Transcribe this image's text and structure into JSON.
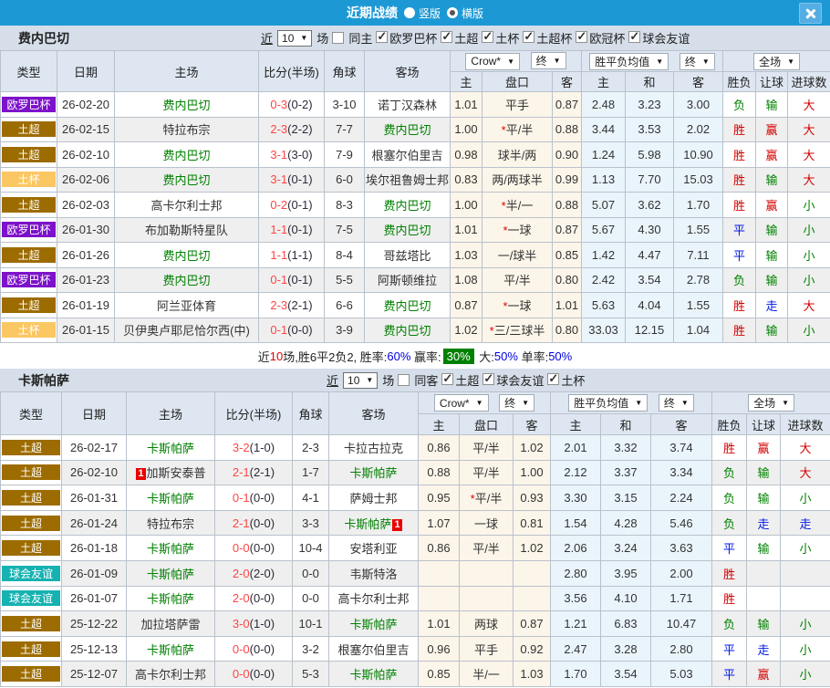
{
  "topbar": {
    "title": "近期战绩",
    "vertical_label": "竖版",
    "horizontal_label": "横版",
    "selected": "横版"
  },
  "league_colors": {
    "欧罗巴杯": "#7d12ca",
    "土超": "#9d6c00",
    "土杯": "#fbc763",
    "球会友谊": "#16b2b2"
  },
  "columns": {
    "type": "类型",
    "date": "日期",
    "home": "主场",
    "score": "比分(半场)",
    "corner": "角球",
    "away": "客场",
    "odds_home": "主",
    "handicap": "盘口",
    "odds_away": "客",
    "mean_home": "主",
    "mean_draw": "和",
    "mean_away": "客",
    "outcome": "胜负",
    "handicap_result": "让球",
    "goals": "进球数"
  },
  "header_selects": {
    "odds_source": "Crow*",
    "odds_final": "终",
    "mean_source": "胜平负均值",
    "mean_final": "终",
    "scope": "全场"
  },
  "sections": [
    {
      "team": "费内巴切",
      "filter": {
        "near": "近",
        "count": "10",
        "games": "场",
        "same_label": "同主",
        "same_checked": false,
        "leagues": [
          "欧罗巴杯",
          "土超",
          "土杯",
          "土超杯",
          "欧冠杯",
          "球会友谊"
        ]
      },
      "rows": [
        {
          "league": "欧罗巴杯",
          "date": "26-02-20",
          "home": {
            "name": "费内巴切",
            "focal": true
          },
          "ft": "0-3",
          "ht": "(0-2)",
          "corner": "3-10",
          "away": {
            "name": "诺丁汉森林"
          },
          "odds": [
            "1.01",
            "平手",
            "0.87"
          ],
          "mean": [
            "2.48",
            "3.23",
            "3.00"
          ],
          "outcome": [
            "负",
            "green"
          ],
          "let": [
            "输",
            "green"
          ],
          "goal": [
            "大",
            "red"
          ]
        },
        {
          "league": "土超",
          "date": "26-02-15",
          "home": {
            "name": "特拉布宗"
          },
          "ft": "2-3",
          "ht": "(2-2)",
          "corner": "7-7",
          "away": {
            "name": "费内巴切",
            "focal": true
          },
          "odds": [
            "1.00",
            "*平/半",
            "0.88"
          ],
          "mean": [
            "3.44",
            "3.53",
            "2.02"
          ],
          "outcome": [
            "胜",
            "red"
          ],
          "let": [
            "赢",
            "red"
          ],
          "goal": [
            "大",
            "red"
          ]
        },
        {
          "league": "土超",
          "date": "26-02-10",
          "home": {
            "name": "费内巴切",
            "focal": true
          },
          "ft": "3-1",
          "ht": "(3-0)",
          "corner": "7-9",
          "away": {
            "name": "根塞尔伯里吉"
          },
          "odds": [
            "0.98",
            "球半/两",
            "0.90"
          ],
          "mean": [
            "1.24",
            "5.98",
            "10.90"
          ],
          "outcome": [
            "胜",
            "red"
          ],
          "let": [
            "赢",
            "red"
          ],
          "goal": [
            "大",
            "red"
          ]
        },
        {
          "league": "土杯",
          "date": "26-02-06",
          "home": {
            "name": "费内巴切",
            "focal": true
          },
          "ft": "3-1",
          "ht": "(0-1)",
          "corner": "6-0",
          "away": {
            "name": "埃尔祖鲁姆士邦"
          },
          "odds": [
            "0.83",
            "两/两球半",
            "0.99"
          ],
          "mean": [
            "1.13",
            "7.70",
            "15.03"
          ],
          "outcome": [
            "胜",
            "red"
          ],
          "let": [
            "输",
            "green"
          ],
          "goal": [
            "大",
            "red"
          ]
        },
        {
          "league": "土超",
          "date": "26-02-03",
          "home": {
            "name": "高卡尔利士邦"
          },
          "ft": "0-2",
          "ht": "(0-1)",
          "corner": "8-3",
          "away": {
            "name": "费内巴切",
            "focal": true
          },
          "odds": [
            "1.00",
            "*半/一",
            "0.88"
          ],
          "mean": [
            "5.07",
            "3.62",
            "1.70"
          ],
          "outcome": [
            "胜",
            "red"
          ],
          "let": [
            "赢",
            "red"
          ],
          "goal": [
            "小",
            "green"
          ]
        },
        {
          "league": "欧罗巴杯",
          "date": "26-01-30",
          "home": {
            "name": "布加勒斯特星队"
          },
          "ft": "1-1",
          "ht": "(0-1)",
          "corner": "7-5",
          "away": {
            "name": "费内巴切",
            "focal": true
          },
          "odds": [
            "1.01",
            "*一球",
            "0.87"
          ],
          "mean": [
            "5.67",
            "4.30",
            "1.55"
          ],
          "outcome": [
            "平",
            "blue"
          ],
          "let": [
            "输",
            "green"
          ],
          "goal": [
            "小",
            "green"
          ]
        },
        {
          "league": "土超",
          "date": "26-01-26",
          "home": {
            "name": "费内巴切",
            "focal": true
          },
          "ft": "1-1",
          "ht": "(1-1)",
          "corner": "8-4",
          "away": {
            "name": "哥兹塔比"
          },
          "odds": [
            "1.03",
            "一/球半",
            "0.85"
          ],
          "mean": [
            "1.42",
            "4.47",
            "7.11"
          ],
          "outcome": [
            "平",
            "blue"
          ],
          "let": [
            "输",
            "green"
          ],
          "goal": [
            "小",
            "green"
          ]
        },
        {
          "league": "欧罗巴杯",
          "date": "26-01-23",
          "home": {
            "name": "费内巴切",
            "focal": true
          },
          "ft": "0-1",
          "ht": "(0-1)",
          "corner": "5-5",
          "away": {
            "name": "阿斯顿维拉"
          },
          "odds": [
            "1.08",
            "平/半",
            "0.80"
          ],
          "mean": [
            "2.42",
            "3.54",
            "2.78"
          ],
          "outcome": [
            "负",
            "green"
          ],
          "let": [
            "输",
            "green"
          ],
          "goal": [
            "小",
            "green"
          ]
        },
        {
          "league": "土超",
          "date": "26-01-19",
          "home": {
            "name": "阿兰亚体育"
          },
          "ft": "2-3",
          "ht": "(2-1)",
          "corner": "6-6",
          "away": {
            "name": "费内巴切",
            "focal": true
          },
          "odds": [
            "0.87",
            "*一球",
            "1.01"
          ],
          "mean": [
            "5.63",
            "4.04",
            "1.55"
          ],
          "outcome": [
            "胜",
            "red"
          ],
          "let": [
            "走",
            "blue"
          ],
          "goal": [
            "大",
            "red"
          ]
        },
        {
          "league": "土杯",
          "date": "26-01-15",
          "home": {
            "name": "贝伊奥卢耶尼恰尔西(中)"
          },
          "ft": "0-1",
          "ht": "(0-0)",
          "corner": "3-9",
          "away": {
            "name": "费内巴切",
            "focal": true
          },
          "odds": [
            "1.02",
            "*三/三球半",
            "0.80"
          ],
          "mean": [
            "33.03",
            "12.15",
            "1.04"
          ],
          "outcome": [
            "胜",
            "red"
          ],
          "let": [
            "输",
            "green"
          ],
          "goal": [
            "小",
            "green"
          ]
        }
      ],
      "summary": [
        {
          "t": "近"
        },
        {
          "t": "10",
          "c": "red"
        },
        {
          "t": "场,胜6平2负2, 胜率:"
        },
        {
          "t": "60%",
          "c": "blue"
        },
        {
          "t": " 赢率:"
        },
        {
          "t": "30%",
          "c": "hl"
        },
        {
          "t": " 大:"
        },
        {
          "t": "50%",
          "c": "blue"
        },
        {
          "t": " 单率:"
        },
        {
          "t": "50%",
          "c": "blue"
        }
      ]
    },
    {
      "team": "卡斯帕萨",
      "filter": {
        "near": "近",
        "count": "10",
        "games": "场",
        "same_label": "同客",
        "same_checked": false,
        "leagues": [
          "土超",
          "球会友谊",
          "土杯"
        ]
      },
      "rows": [
        {
          "league": "土超",
          "date": "26-02-17",
          "home": {
            "name": "卡斯帕萨",
            "focal": true
          },
          "ft": "3-2",
          "ht": "(1-0)",
          "corner": "2-3",
          "away": {
            "name": "卡拉古拉克"
          },
          "odds": [
            "0.86",
            "平/半",
            "1.02"
          ],
          "mean": [
            "2.01",
            "3.32",
            "3.74"
          ],
          "outcome": [
            "胜",
            "red"
          ],
          "let": [
            "赢",
            "red"
          ],
          "goal": [
            "大",
            "red"
          ]
        },
        {
          "league": "土超",
          "date": "26-02-10",
          "home": {
            "name": "加斯安泰普",
            "badge": "1",
            "badge_pos": "before"
          },
          "ft": "2-1",
          "ht": "(2-1)",
          "corner": "1-7",
          "away": {
            "name": "卡斯帕萨",
            "focal": true
          },
          "odds": [
            "0.88",
            "平/半",
            "1.00"
          ],
          "mean": [
            "2.12",
            "3.37",
            "3.34"
          ],
          "outcome": [
            "负",
            "green"
          ],
          "let": [
            "输",
            "green"
          ],
          "goal": [
            "大",
            "red"
          ]
        },
        {
          "league": "土超",
          "date": "26-01-31",
          "home": {
            "name": "卡斯帕萨",
            "focal": true
          },
          "ft": "0-1",
          "ht": "(0-0)",
          "corner": "4-1",
          "away": {
            "name": "萨姆士邦"
          },
          "odds": [
            "0.95",
            "*平/半",
            "0.93"
          ],
          "mean": [
            "3.30",
            "3.15",
            "2.24"
          ],
          "outcome": [
            "负",
            "green"
          ],
          "let": [
            "输",
            "green"
          ],
          "goal": [
            "小",
            "green"
          ]
        },
        {
          "league": "土超",
          "date": "26-01-24",
          "home": {
            "name": "特拉布宗"
          },
          "ft": "2-1",
          "ht": "(0-0)",
          "corner": "3-3",
          "away": {
            "name": "卡斯帕萨",
            "focal": true,
            "badge": "1",
            "badge_pos": "after"
          },
          "odds": [
            "1.07",
            "一球",
            "0.81"
          ],
          "mean": [
            "1.54",
            "4.28",
            "5.46"
          ],
          "outcome": [
            "负",
            "green"
          ],
          "let": [
            "走",
            "blue"
          ],
          "goal": [
            "走",
            "blue"
          ]
        },
        {
          "league": "土超",
          "date": "26-01-18",
          "home": {
            "name": "卡斯帕萨",
            "focal": true
          },
          "ft": "0-0",
          "ht": "(0-0)",
          "corner": "10-4",
          "away": {
            "name": "安塔利亚"
          },
          "odds": [
            "0.86",
            "平/半",
            "1.02"
          ],
          "mean": [
            "2.06",
            "3.24",
            "3.63"
          ],
          "outcome": [
            "平",
            "blue"
          ],
          "let": [
            "输",
            "green"
          ],
          "goal": [
            "小",
            "green"
          ]
        },
        {
          "league": "球会友谊",
          "date": "26-01-09",
          "home": {
            "name": "卡斯帕萨",
            "focal": true
          },
          "ft": "2-0",
          "ht": "(2-0)",
          "corner": "0-0",
          "away": {
            "name": "韦斯特洛"
          },
          "odds": [
            "",
            "",
            ""
          ],
          "mean": [
            "2.80",
            "3.95",
            "2.00"
          ],
          "outcome": [
            "胜",
            "red"
          ],
          "let": [
            "",
            ""
          ],
          "goal": [
            "",
            ""
          ]
        },
        {
          "league": "球会友谊",
          "date": "26-01-07",
          "home": {
            "name": "卡斯帕萨",
            "focal": true
          },
          "ft": "2-0",
          "ht": "(0-0)",
          "corner": "0-0",
          "away": {
            "name": "高卡尔利士邦"
          },
          "odds": [
            "",
            "",
            ""
          ],
          "mean": [
            "3.56",
            "4.10",
            "1.71"
          ],
          "outcome": [
            "胜",
            "red"
          ],
          "let": [
            "",
            ""
          ],
          "goal": [
            "",
            ""
          ]
        },
        {
          "league": "土超",
          "date": "25-12-22",
          "home": {
            "name": "加拉塔萨雷"
          },
          "ft": "3-0",
          "ht": "(1-0)",
          "corner": "10-1",
          "away": {
            "name": "卡斯帕萨",
            "focal": true
          },
          "odds": [
            "1.01",
            "两球",
            "0.87"
          ],
          "mean": [
            "1.21",
            "6.83",
            "10.47"
          ],
          "outcome": [
            "负",
            "green"
          ],
          "let": [
            "输",
            "green"
          ],
          "goal": [
            "小",
            "green"
          ]
        },
        {
          "league": "土超",
          "date": "25-12-13",
          "home": {
            "name": "卡斯帕萨",
            "focal": true
          },
          "ft": "0-0",
          "ht": "(0-0)",
          "corner": "3-2",
          "away": {
            "name": "根塞尔伯里吉"
          },
          "odds": [
            "0.96",
            "平手",
            "0.92"
          ],
          "mean": [
            "2.47",
            "3.28",
            "2.80"
          ],
          "outcome": [
            "平",
            "blue"
          ],
          "let": [
            "走",
            "blue"
          ],
          "goal": [
            "小",
            "green"
          ]
        },
        {
          "league": "土超",
          "date": "25-12-07",
          "home": {
            "name": "高卡尔利士邦"
          },
          "ft": "0-0",
          "ht": "(0-0)",
          "corner": "5-3",
          "away": {
            "name": "卡斯帕萨",
            "focal": true
          },
          "odds": [
            "0.85",
            "半/一",
            "1.03"
          ],
          "mean": [
            "1.70",
            "3.54",
            "5.03"
          ],
          "outcome": [
            "平",
            "blue"
          ],
          "let": [
            "赢",
            "red"
          ],
          "goal": [
            "小",
            "green"
          ]
        }
      ],
      "summary": []
    }
  ]
}
